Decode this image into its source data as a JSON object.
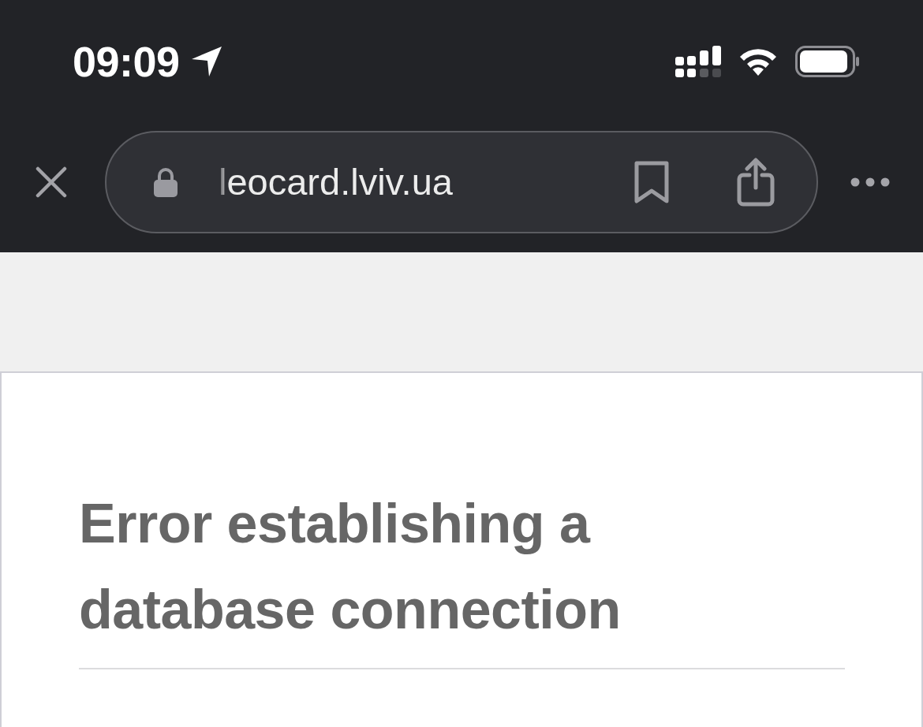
{
  "status_bar": {
    "time": "09:09"
  },
  "browser_bar": {
    "url": "leocard.lviv.ua"
  },
  "page": {
    "heading": "Error establishing a database connection"
  }
}
